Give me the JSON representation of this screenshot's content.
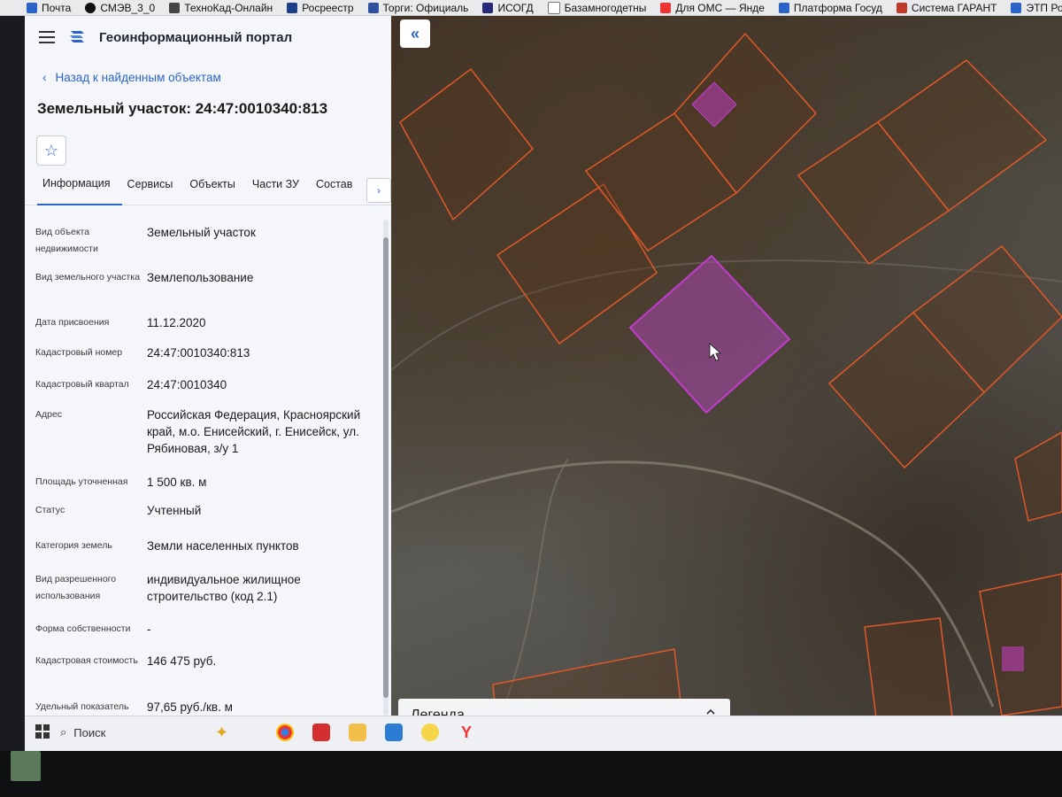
{
  "bookmarks": [
    "Почта",
    "СМЭВ_3_0",
    "ТехноКад-Онлайн",
    "Росреестр",
    "Торги: Официаль",
    "ИСОГД",
    "Базамногодетны",
    "Для ОМС — Янде",
    "Платформа Госуд",
    "Система ГАРАНТ",
    "ЭТП Росэлторг"
  ],
  "header": {
    "title": "Геоинформационный портал"
  },
  "back_link": "Назад к найденным объектам",
  "object_title": "Земельный участок: 24:47:0010340:813",
  "tabs": [
    "Информация",
    "Сервисы",
    "Объекты",
    "Части ЗУ",
    "Состав"
  ],
  "attributes": [
    {
      "label": "Вид объекта недвижимости",
      "value": "Земельный участок"
    },
    {
      "label": "Вид земельного участка",
      "value": "Землепользование"
    },
    {
      "label": "Дата присвоения",
      "value": "11.12.2020"
    },
    {
      "label": "Кадастровый номер",
      "value": "24:47:0010340:813"
    },
    {
      "label": "Кадастровый квартал",
      "value": "24:47:0010340"
    },
    {
      "label": "Адрес",
      "value": "Российская Федерация, Красноярский край, м.о. Енисейский, г. Енисейск, ул. Рябиновая, з/у 1"
    },
    {
      "label": "Площадь уточненная",
      "value": "1 500 кв. м"
    },
    {
      "label": "Статус",
      "value": "Учтенный"
    },
    {
      "label": "Категория земель",
      "value": "Земли населенных пунктов"
    },
    {
      "label": "Вид разрешенного использования",
      "value": "индивидуальное жилищное строительство (код 2.1)"
    },
    {
      "label": "Форма собственности",
      "value": "-"
    },
    {
      "label": "Кадастровая стоимость",
      "value": "146 475 руб."
    },
    {
      "label": "Удельный показатель кадастровой",
      "value": "97,65 руб./кв. м"
    }
  ],
  "legend": {
    "label": "Легенда"
  },
  "taskbar": {
    "search_label": "Поиск"
  },
  "colors": {
    "accent": "#2b64c8",
    "parcel_outline": "#e0582a",
    "selected_parcel": "#c23ccf"
  }
}
